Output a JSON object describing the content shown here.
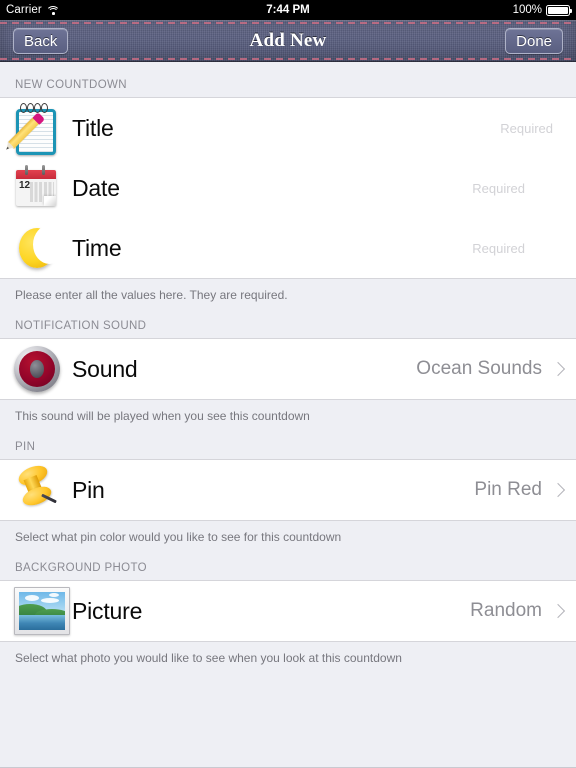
{
  "status_bar": {
    "carrier": "Carrier",
    "wifi_icon": "wifi-icon",
    "time": "7:44 PM",
    "battery_percent": "100%",
    "battery_icon": "battery-full-icon"
  },
  "nav_bar": {
    "back_label": "Back",
    "title": "Add New",
    "done_label": "Done"
  },
  "sections": [
    {
      "header": "NEW COUNTDOWN",
      "footer": "Please enter all the values here. They are required.",
      "rows": [
        {
          "icon": "memo-pencil-icon",
          "label": "Title",
          "placeholder": "Required"
        },
        {
          "icon": "calendar-icon",
          "label": "Date",
          "placeholder": "Required"
        },
        {
          "icon": "crescent-moon-icon",
          "label": "Time",
          "placeholder": "Required"
        }
      ]
    },
    {
      "header": "NOTIFICATION SOUND",
      "footer": "This sound will be played when you see this countdown",
      "rows": [
        {
          "icon": "speaker-icon",
          "label": "Sound",
          "value": "Ocean Sounds",
          "chevron": "chevron-right-icon"
        }
      ]
    },
    {
      "header": "PIN",
      "footer": "Select what pin color would you like to see for this countdown",
      "rows": [
        {
          "icon": "pushpin-icon",
          "label": "Pin",
          "value": "Pin Red",
          "chevron": "chevron-right-icon"
        }
      ]
    },
    {
      "header": "BACKGROUND PHOTO",
      "footer": "Select what photo you would like to see when you look at this countdown",
      "rows": [
        {
          "icon": "framed-picture-icon",
          "label": "Picture",
          "value": "Random",
          "chevron": "chevron-right-icon"
        }
      ]
    }
  ],
  "colors": {
    "nav_bar": "#5b6080",
    "nav_stitch": "#c86d84",
    "page_background": "#eeeff4",
    "row_background": "#ffffff",
    "section_header_text": "#8b8b93",
    "value_text": "#8e8e94",
    "placeholder_text": "#d2d2d6",
    "label_text": "#0a0a0a"
  }
}
